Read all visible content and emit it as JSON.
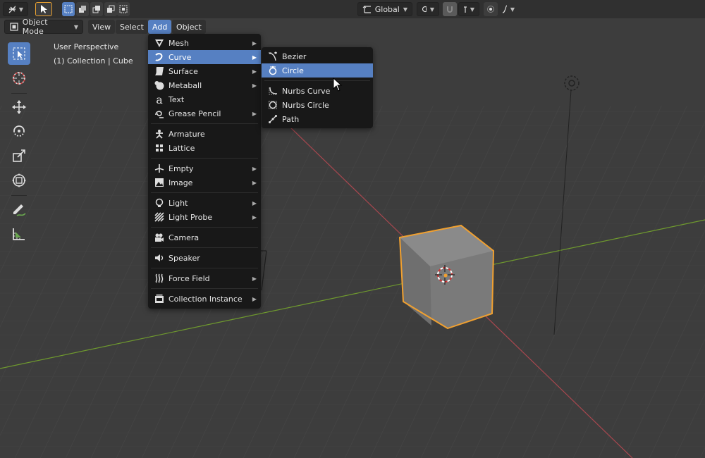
{
  "header": {
    "orientation_label": "Global",
    "selected_tool_color": "#5680c2"
  },
  "mode_bar": {
    "mode_label": "Object Mode",
    "menus": [
      "View",
      "Select",
      "Add",
      "Object"
    ],
    "active_menu": "Add"
  },
  "viewport": {
    "perspective_label": "User Perspective",
    "collection_label": "(1) Collection | Cube"
  },
  "toolbar": {
    "tools": [
      "select-box-icon",
      "cursor-icon",
      "move-icon",
      "rotate-icon",
      "scale-icon",
      "transform-icon",
      "annotate-icon",
      "measure-icon"
    ]
  },
  "add_menu": {
    "items": [
      {
        "label": "Mesh",
        "icon": "mesh-icon",
        "submenu": true
      },
      {
        "label": "Curve",
        "icon": "curve-icon",
        "submenu": true,
        "highlighted": true
      },
      {
        "label": "Surface",
        "icon": "surface-icon",
        "submenu": true
      },
      {
        "label": "Metaball",
        "icon": "metaball-icon",
        "submenu": true
      },
      {
        "label": "Text",
        "icon": "text-icon",
        "submenu": false
      },
      {
        "label": "Grease Pencil",
        "icon": "grease-pencil-icon",
        "submenu": true
      },
      {
        "label": "Armature",
        "icon": "armature-icon",
        "submenu": false
      },
      {
        "label": "Lattice",
        "icon": "lattice-icon",
        "submenu": false
      },
      {
        "label": "Empty",
        "icon": "empty-icon",
        "submenu": true
      },
      {
        "label": "Image",
        "icon": "image-icon",
        "submenu": true
      },
      {
        "label": "Light",
        "icon": "light-icon",
        "submenu": true
      },
      {
        "label": "Light Probe",
        "icon": "light-probe-icon",
        "submenu": true
      },
      {
        "label": "Camera",
        "icon": "camera-icon",
        "submenu": false
      },
      {
        "label": "Speaker",
        "icon": "speaker-icon",
        "submenu": false
      },
      {
        "label": "Force Field",
        "icon": "force-field-icon",
        "submenu": true
      },
      {
        "label": "Collection Instance",
        "icon": "collection-instance-icon",
        "submenu": true
      }
    ]
  },
  "curve_submenu": {
    "items": [
      {
        "label": "Bezier",
        "icon": "bezier-icon"
      },
      {
        "label": "Circle",
        "icon": "circle-curve-icon",
        "highlighted": true
      },
      {
        "label": "Nurbs Curve",
        "icon": "nurbs-curve-icon"
      },
      {
        "label": "Nurbs Circle",
        "icon": "nurbs-circle-icon"
      },
      {
        "label": "Path",
        "icon": "path-icon"
      }
    ]
  },
  "colors": {
    "highlight": "#5680c2",
    "selection_outline": "#f0a030",
    "x_axis": "#a8474f",
    "y_axis": "#6f9a2e"
  }
}
